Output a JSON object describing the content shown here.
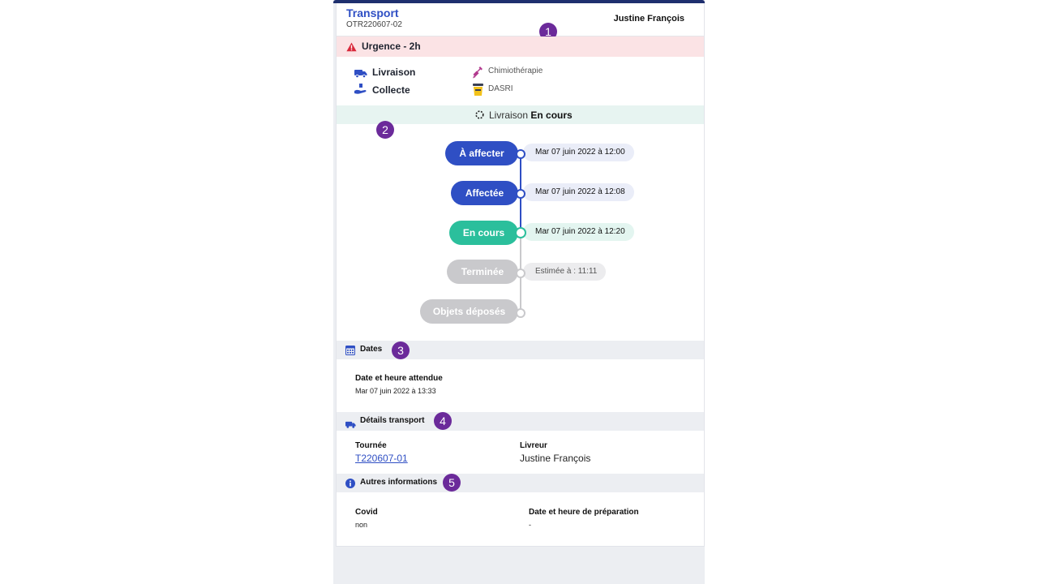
{
  "header": {
    "title": "Transport",
    "code": "OTR220607-02",
    "user": "Justine François"
  },
  "badges": [
    "1",
    "2",
    "3",
    "4",
    "5"
  ],
  "urgency": {
    "label": "Urgence - 2h",
    "icon": "warning-triangle-icon",
    "color": "#d9283a"
  },
  "types": [
    {
      "label": "Livraison",
      "icon": "truck-icon"
    },
    {
      "label": "Collecte",
      "icon": "hand-package-icon"
    }
  ],
  "categories": [
    {
      "label": "Chimiothérapie",
      "icon": "syringe-icon"
    },
    {
      "label": "DASRI",
      "icon": "waste-bin-icon"
    }
  ],
  "status": {
    "prefix": "Livraison",
    "value": "En cours",
    "icon": "loading-spinner-icon"
  },
  "timeline": [
    {
      "label": "À affecter",
      "date": "Mar 07 juin 2022 à 12:00",
      "state": "done"
    },
    {
      "label": "Affectée",
      "date": "Mar 07 juin 2022 à 12:08",
      "state": "done"
    },
    {
      "label": "En cours",
      "date": "Mar 07 juin 2022 à 12:20",
      "state": "current"
    },
    {
      "label": "Terminée",
      "date": "Estimée à : 11:11",
      "state": "pending"
    },
    {
      "label": "Objets déposés",
      "date": "",
      "state": "pending"
    }
  ],
  "colors": {
    "done": "#2f4fc4",
    "current": "#2bbf9c",
    "pending": "#c9c9cc",
    "badge": "#6b2a9a"
  },
  "sections": {
    "dates": {
      "title": "Dates",
      "field_label": "Date et heure attendue",
      "field_value": "Mar 07 juin 2022 à 13:33"
    },
    "transport": {
      "title": "Détails transport",
      "tournee_label": "Tournée",
      "tournee_value": "T220607-01",
      "livreur_label": "Livreur",
      "livreur_value": "Justine François"
    },
    "other": {
      "title": "Autres informations",
      "covid_label": "Covid",
      "covid_value": "non",
      "prep_label": "Date et heure de préparation",
      "prep_value": "-"
    }
  }
}
